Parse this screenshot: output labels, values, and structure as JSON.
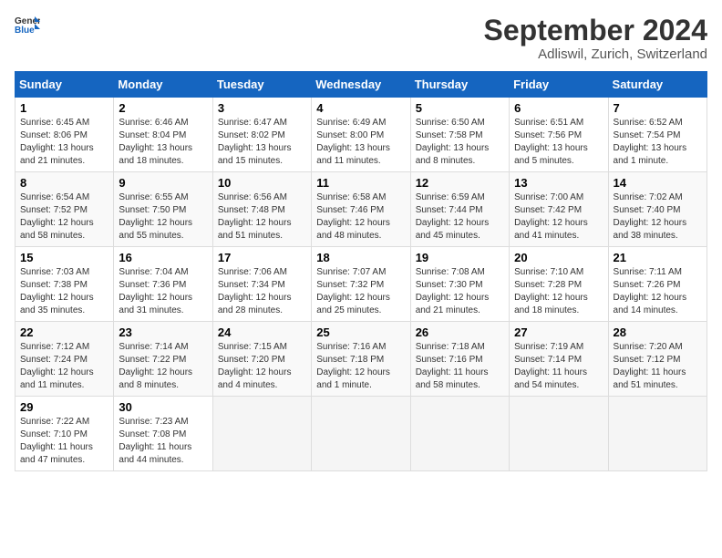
{
  "header": {
    "logo": {
      "text_general": "General",
      "text_blue": "Blue"
    },
    "title": "September 2024",
    "subtitle": "Adliswil, Zurich, Switzerland"
  },
  "calendar": {
    "days_of_week": [
      "Sunday",
      "Monday",
      "Tuesday",
      "Wednesday",
      "Thursday",
      "Friday",
      "Saturday"
    ],
    "weeks": [
      {
        "days": [
          {
            "number": "1",
            "sunrise": "Sunrise: 6:45 AM",
            "sunset": "Sunset: 8:06 PM",
            "daylight": "Daylight: 13 hours and 21 minutes."
          },
          {
            "number": "2",
            "sunrise": "Sunrise: 6:46 AM",
            "sunset": "Sunset: 8:04 PM",
            "daylight": "Daylight: 13 hours and 18 minutes."
          },
          {
            "number": "3",
            "sunrise": "Sunrise: 6:47 AM",
            "sunset": "Sunset: 8:02 PM",
            "daylight": "Daylight: 13 hours and 15 minutes."
          },
          {
            "number": "4",
            "sunrise": "Sunrise: 6:49 AM",
            "sunset": "Sunset: 8:00 PM",
            "daylight": "Daylight: 13 hours and 11 minutes."
          },
          {
            "number": "5",
            "sunrise": "Sunrise: 6:50 AM",
            "sunset": "Sunset: 7:58 PM",
            "daylight": "Daylight: 13 hours and 8 minutes."
          },
          {
            "number": "6",
            "sunrise": "Sunrise: 6:51 AM",
            "sunset": "Sunset: 7:56 PM",
            "daylight": "Daylight: 13 hours and 5 minutes."
          },
          {
            "number": "7",
            "sunrise": "Sunrise: 6:52 AM",
            "sunset": "Sunset: 7:54 PM",
            "daylight": "Daylight: 13 hours and 1 minute."
          }
        ]
      },
      {
        "days": [
          {
            "number": "8",
            "sunrise": "Sunrise: 6:54 AM",
            "sunset": "Sunset: 7:52 PM",
            "daylight": "Daylight: 12 hours and 58 minutes."
          },
          {
            "number": "9",
            "sunrise": "Sunrise: 6:55 AM",
            "sunset": "Sunset: 7:50 PM",
            "daylight": "Daylight: 12 hours and 55 minutes."
          },
          {
            "number": "10",
            "sunrise": "Sunrise: 6:56 AM",
            "sunset": "Sunset: 7:48 PM",
            "daylight": "Daylight: 12 hours and 51 minutes."
          },
          {
            "number": "11",
            "sunrise": "Sunrise: 6:58 AM",
            "sunset": "Sunset: 7:46 PM",
            "daylight": "Daylight: 12 hours and 48 minutes."
          },
          {
            "number": "12",
            "sunrise": "Sunrise: 6:59 AM",
            "sunset": "Sunset: 7:44 PM",
            "daylight": "Daylight: 12 hours and 45 minutes."
          },
          {
            "number": "13",
            "sunrise": "Sunrise: 7:00 AM",
            "sunset": "Sunset: 7:42 PM",
            "daylight": "Daylight: 12 hours and 41 minutes."
          },
          {
            "number": "14",
            "sunrise": "Sunrise: 7:02 AM",
            "sunset": "Sunset: 7:40 PM",
            "daylight": "Daylight: 12 hours and 38 minutes."
          }
        ]
      },
      {
        "days": [
          {
            "number": "15",
            "sunrise": "Sunrise: 7:03 AM",
            "sunset": "Sunset: 7:38 PM",
            "daylight": "Daylight: 12 hours and 35 minutes."
          },
          {
            "number": "16",
            "sunrise": "Sunrise: 7:04 AM",
            "sunset": "Sunset: 7:36 PM",
            "daylight": "Daylight: 12 hours and 31 minutes."
          },
          {
            "number": "17",
            "sunrise": "Sunrise: 7:06 AM",
            "sunset": "Sunset: 7:34 PM",
            "daylight": "Daylight: 12 hours and 28 minutes."
          },
          {
            "number": "18",
            "sunrise": "Sunrise: 7:07 AM",
            "sunset": "Sunset: 7:32 PM",
            "daylight": "Daylight: 12 hours and 25 minutes."
          },
          {
            "number": "19",
            "sunrise": "Sunrise: 7:08 AM",
            "sunset": "Sunset: 7:30 PM",
            "daylight": "Daylight: 12 hours and 21 minutes."
          },
          {
            "number": "20",
            "sunrise": "Sunrise: 7:10 AM",
            "sunset": "Sunset: 7:28 PM",
            "daylight": "Daylight: 12 hours and 18 minutes."
          },
          {
            "number": "21",
            "sunrise": "Sunrise: 7:11 AM",
            "sunset": "Sunset: 7:26 PM",
            "daylight": "Daylight: 12 hours and 14 minutes."
          }
        ]
      },
      {
        "days": [
          {
            "number": "22",
            "sunrise": "Sunrise: 7:12 AM",
            "sunset": "Sunset: 7:24 PM",
            "daylight": "Daylight: 12 hours and 11 minutes."
          },
          {
            "number": "23",
            "sunrise": "Sunrise: 7:14 AM",
            "sunset": "Sunset: 7:22 PM",
            "daylight": "Daylight: 12 hours and 8 minutes."
          },
          {
            "number": "24",
            "sunrise": "Sunrise: 7:15 AM",
            "sunset": "Sunset: 7:20 PM",
            "daylight": "Daylight: 12 hours and 4 minutes."
          },
          {
            "number": "25",
            "sunrise": "Sunrise: 7:16 AM",
            "sunset": "Sunset: 7:18 PM",
            "daylight": "Daylight: 12 hours and 1 minute."
          },
          {
            "number": "26",
            "sunrise": "Sunrise: 7:18 AM",
            "sunset": "Sunset: 7:16 PM",
            "daylight": "Daylight: 11 hours and 58 minutes."
          },
          {
            "number": "27",
            "sunrise": "Sunrise: 7:19 AM",
            "sunset": "Sunset: 7:14 PM",
            "daylight": "Daylight: 11 hours and 54 minutes."
          },
          {
            "number": "28",
            "sunrise": "Sunrise: 7:20 AM",
            "sunset": "Sunset: 7:12 PM",
            "daylight": "Daylight: 11 hours and 51 minutes."
          }
        ]
      },
      {
        "days": [
          {
            "number": "29",
            "sunrise": "Sunrise: 7:22 AM",
            "sunset": "Sunset: 7:10 PM",
            "daylight": "Daylight: 11 hours and 47 minutes."
          },
          {
            "number": "30",
            "sunrise": "Sunrise: 7:23 AM",
            "sunset": "Sunset: 7:08 PM",
            "daylight": "Daylight: 11 hours and 44 minutes."
          },
          {
            "number": "",
            "sunrise": "",
            "sunset": "",
            "daylight": ""
          },
          {
            "number": "",
            "sunrise": "",
            "sunset": "",
            "daylight": ""
          },
          {
            "number": "",
            "sunrise": "",
            "sunset": "",
            "daylight": ""
          },
          {
            "number": "",
            "sunrise": "",
            "sunset": "",
            "daylight": ""
          },
          {
            "number": "",
            "sunrise": "",
            "sunset": "",
            "daylight": ""
          }
        ]
      }
    ]
  }
}
